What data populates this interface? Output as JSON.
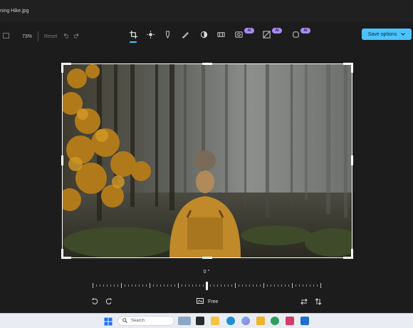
{
  "window": {
    "title": "ning Hike.jpg"
  },
  "toolbar": {
    "zoom": "73%",
    "reset_label": "Reset",
    "ai_badge": "AI",
    "save_label": "Save options",
    "tools": [
      "crop-icon",
      "brightness-icon",
      "markup-icon",
      "draw-icon",
      "filter-icon",
      "frame-icon",
      "background-icon",
      "erase-icon",
      "generative-icon"
    ]
  },
  "crop": {
    "rotation_label": "0 °",
    "aspect_label": "Free"
  },
  "taskbar": {
    "search_placeholder": "Search",
    "apps": [
      "windows-start-icon",
      "widgets-icon",
      "file-explorer-icon",
      "edge-icon",
      "copilot-icon",
      "folder-icon",
      "chrome-icon",
      "store-icon",
      "photos-icon",
      "app-icon"
    ]
  },
  "colors": {
    "accent": "#4cc2ff",
    "ai_badge": "#a98bf0",
    "background": "#1c1c1c"
  }
}
